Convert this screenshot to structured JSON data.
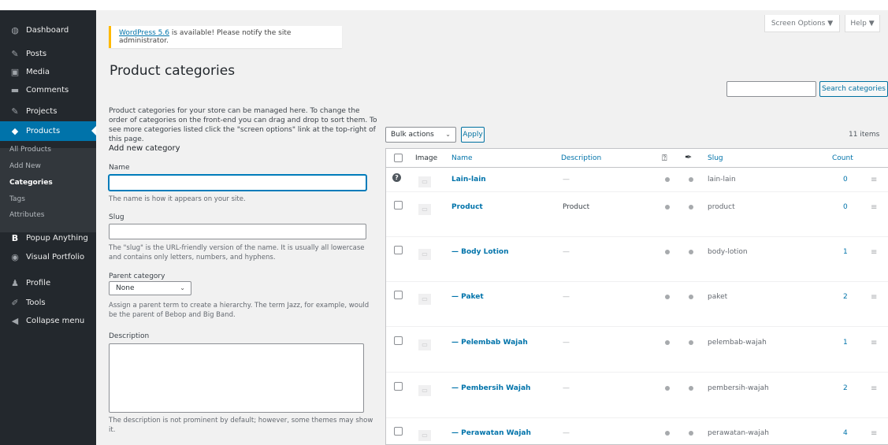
{
  "sidebar": {
    "items": [
      {
        "label": "Dashboard",
        "icon": "dashboard-icon",
        "glyph": "◍"
      },
      {
        "label": "Posts",
        "icon": "pin-icon",
        "glyph": "✎"
      },
      {
        "label": "Media",
        "icon": "media-icon",
        "glyph": "▣"
      },
      {
        "label": "Comments",
        "icon": "comment-icon",
        "glyph": "▬"
      },
      {
        "label": "Projects",
        "icon": "pin-icon",
        "glyph": "✎"
      },
      {
        "label": "Products",
        "icon": "products-icon",
        "glyph": "◆"
      },
      {
        "label": "Popup Anything",
        "icon": "b-icon",
        "glyph": "B"
      },
      {
        "label": "Visual Portfolio",
        "icon": "portfolio-icon",
        "glyph": "◉"
      },
      {
        "label": "Profile",
        "icon": "user-icon",
        "glyph": "♟"
      },
      {
        "label": "Tools",
        "icon": "wrench-icon",
        "glyph": "✐"
      },
      {
        "label": "Collapse menu",
        "icon": "collapse-icon",
        "glyph": "◀"
      }
    ],
    "submenu": [
      "All Products",
      "Add New",
      "Categories",
      "Tags",
      "Attributes"
    ]
  },
  "header": {
    "screen_options": "Screen Options ▼",
    "help": "Help ▼"
  },
  "notice": {
    "link": "WordPress 5.6",
    "text": " is available! Please notify the site administrator."
  },
  "page_title": "Product categories",
  "search": {
    "button": "Search categories",
    "value": ""
  },
  "form": {
    "intro": "Product categories for your store can be managed here. To change the order of categories on the front-end you can drag and drop to sort them. To see more categories listed click the \"screen options\" link at the top-right of this page.",
    "heading": "Add new category",
    "name_label": "Name",
    "name_hint": "The name is how it appears on your site.",
    "slug_label": "Slug",
    "slug_hint": "The \"slug\" is the URL-friendly version of the name. It is usually all lowercase and contains only letters, numbers, and hyphens.",
    "parent_label": "Parent category",
    "parent_value": "None",
    "parent_hint": "Assign a parent term to create a hierarchy. The term Jazz, for example, would be the parent of Bebop and Big Band.",
    "desc_label": "Description",
    "desc_hint": "The description is not prominent by default; however, some themes may show it."
  },
  "table": {
    "bulk_actions": "Bulk actions",
    "apply": "Apply",
    "items_count": "11 items",
    "headers": {
      "image": "Image",
      "name": "Name",
      "description": "Description",
      "slug": "Slug",
      "count": "Count"
    },
    "rows": [
      {
        "name": "Lain-lain",
        "description": "—",
        "slug": "lain-lain",
        "count": "0"
      },
      {
        "name": "Product",
        "description": "Product",
        "slug": "product",
        "count": "0"
      },
      {
        "name": "— Body Lotion",
        "description": "—",
        "slug": "body-lotion",
        "count": "1"
      },
      {
        "name": "— Paket",
        "description": "—",
        "slug": "paket",
        "count": "2"
      },
      {
        "name": "— Pelembab Wajah",
        "description": "—",
        "slug": "pelembab-wajah",
        "count": "1"
      },
      {
        "name": "— Pembersih Wajah",
        "description": "—",
        "slug": "pembersih-wajah",
        "count": "2"
      },
      {
        "name": "— Perawatan Wajah",
        "description": "—",
        "slug": "perawatan-wajah",
        "count": "4"
      }
    ],
    "handle_glyph": "≡",
    "thumb_glyph": "▭"
  },
  "colors": {
    "sidebar": "#23282d",
    "accent": "#0073aa",
    "notice": "#ffb900"
  }
}
